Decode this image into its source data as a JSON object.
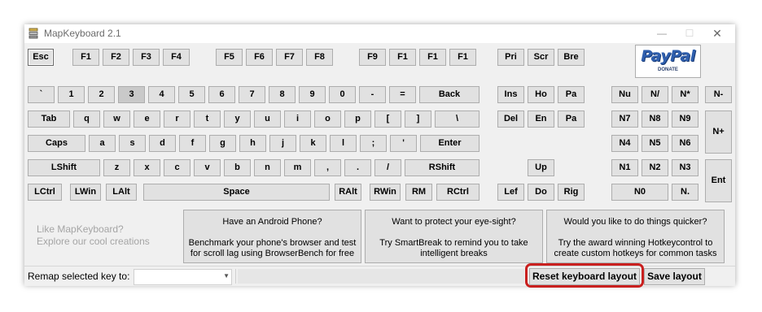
{
  "window": {
    "title": "MapKeyboard 2.1",
    "minimize": "—",
    "maximize": "☐",
    "close": "✕"
  },
  "keyboard": {
    "function_row": [
      "Esc",
      "F1",
      "F2",
      "F3",
      "F4",
      "F5",
      "F6",
      "F7",
      "F8",
      "F9",
      "F1",
      "F1",
      "F1"
    ],
    "system_row": [
      "Pri",
      "Scr",
      "Bre"
    ],
    "number_row": [
      "`",
      "1",
      "2",
      "3",
      "4",
      "5",
      "6",
      "7",
      "8",
      "9",
      "0",
      "-",
      "=",
      "Back"
    ],
    "tab_row": [
      "Tab",
      "q",
      "w",
      "e",
      "r",
      "t",
      "y",
      "u",
      "i",
      "o",
      "p",
      "[",
      "]",
      "\\"
    ],
    "caps_row": [
      "Caps",
      "a",
      "s",
      "d",
      "f",
      "g",
      "h",
      "j",
      "k",
      "l",
      ";",
      "'",
      "Enter"
    ],
    "shift_row": [
      "LShift",
      "z",
      "x",
      "c",
      "v",
      "b",
      "n",
      "m",
      ",",
      ".",
      "/",
      "RShift"
    ],
    "bottom_row": [
      "LCtrl",
      "LWin",
      "LAlt",
      "Space",
      "RAlt",
      "RWin",
      "RM",
      "RCtrl"
    ],
    "nav_row1": [
      "Ins",
      "Ho",
      "Pa"
    ],
    "nav_row2": [
      "Del",
      "En",
      "Pa"
    ],
    "arrow_up": "Up",
    "arrows_bottom": [
      "Lef",
      "Do",
      "Rig"
    ],
    "numpad_row1": [
      "Nu",
      "N/",
      "N*",
      "N-"
    ],
    "numpad_row2": [
      "N7",
      "N8",
      "N9"
    ],
    "numpad_plus": "N+",
    "numpad_row3": [
      "N4",
      "N5",
      "N6"
    ],
    "numpad_row4": [
      "N1",
      "N2",
      "N3"
    ],
    "numpad_enter": "Ent",
    "numpad_row5": [
      "N0",
      "N."
    ]
  },
  "paypal": {
    "brand": "PayPal",
    "donate": "DONATE"
  },
  "promo": {
    "line1": "Like MapKeyboard?",
    "line2": "Explore our cool creations"
  },
  "cards": [
    {
      "heading": "Have an Android Phone?",
      "body": "Benchmark your phone's browser and test for scroll lag using BrowserBench for free"
    },
    {
      "heading": "Want to protect your eye-sight?",
      "body": "Try SmartBreak to remind you to take intelligent breaks"
    },
    {
      "heading": "Would you like to do things quicker?",
      "body": "Try the award winning Hotkeycontrol to create custom hotkeys for common tasks"
    }
  ],
  "statusbar": {
    "remap_label": "Remap selected key to:",
    "remap_value": "",
    "reset_label": "Reset keyboard layout",
    "save_label": "Save layout"
  },
  "colors": {
    "highlight_ring": "#c9201f",
    "paypal_blue": "#2f5fae"
  }
}
